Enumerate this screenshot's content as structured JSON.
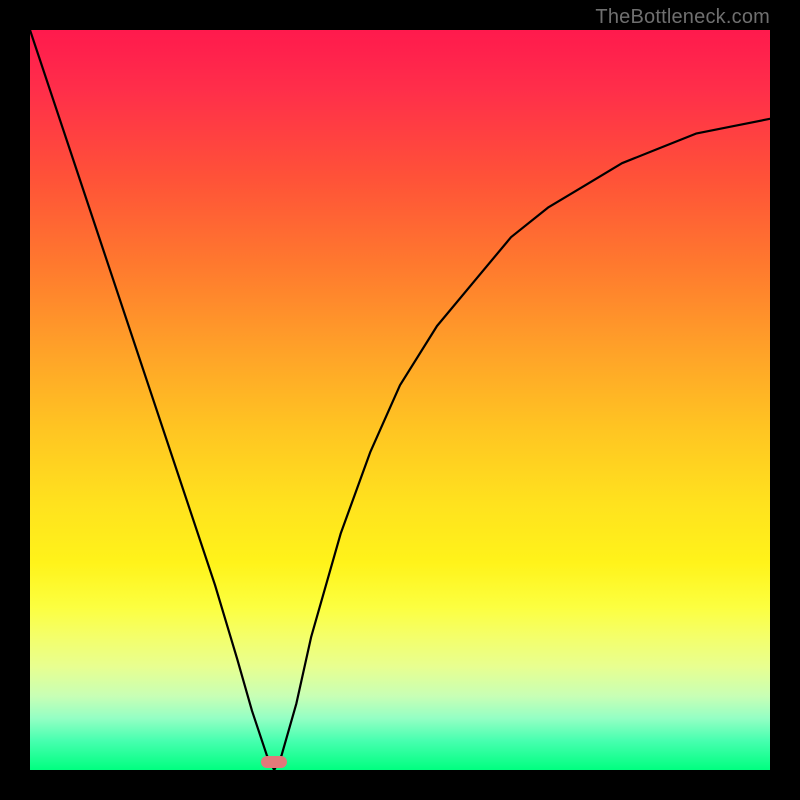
{
  "watermark": "TheBottleneck.com",
  "marker": {
    "x_frac": 0.33,
    "y_frac": 0.992
  },
  "chart_data": {
    "type": "line",
    "title": "",
    "xlabel": "",
    "ylabel": "",
    "xlim": [
      0,
      1
    ],
    "ylim": [
      0,
      1
    ],
    "series": [
      {
        "name": "curve",
        "x": [
          0.0,
          0.05,
          0.1,
          0.15,
          0.2,
          0.25,
          0.28,
          0.3,
          0.32,
          0.33,
          0.34,
          0.36,
          0.38,
          0.42,
          0.46,
          0.5,
          0.55,
          0.6,
          0.65,
          0.7,
          0.75,
          0.8,
          0.85,
          0.9,
          0.95,
          1.0
        ],
        "y": [
          1.0,
          0.85,
          0.7,
          0.55,
          0.4,
          0.25,
          0.15,
          0.08,
          0.02,
          0.0,
          0.02,
          0.09,
          0.18,
          0.32,
          0.43,
          0.52,
          0.6,
          0.66,
          0.72,
          0.76,
          0.79,
          0.82,
          0.84,
          0.86,
          0.87,
          0.88
        ]
      }
    ],
    "background_gradient": {
      "top": "#ff1a4d",
      "mid": "#ffe21e",
      "bottom": "#00ff80"
    },
    "frame_color": "#000000",
    "marker_point": {
      "x": 0.33,
      "y": 0.0,
      "color": "#e07a7a"
    }
  }
}
